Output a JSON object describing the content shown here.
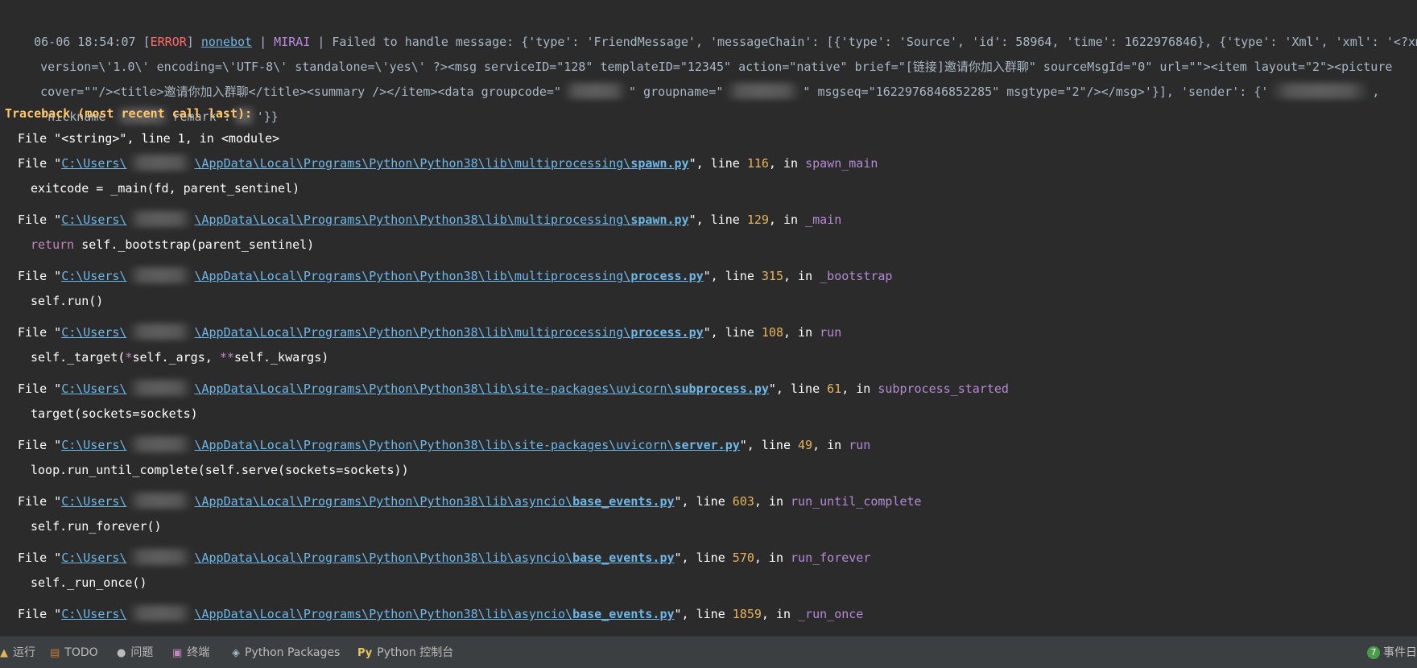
{
  "log": {
    "timestamp": "06-06 18:54:07",
    "level_open": "[",
    "level": "ERROR",
    "level_close": "]",
    "logger": "nonebot",
    "sep1": " | ",
    "adapter": "MIRAI",
    "sep2": " | ",
    "message_1": "Failed to handle message: {'type': 'FriendMessage', 'messageChain': [{'type': 'Source', 'id': 58964, 'time': 1622976846}, {'type': 'Xml', 'xml': '<?xml",
    "message_2": "version=\\'1.0\\' encoding=\\'UTF-8\\' standalone=\\'yes\\' ?><msg serviceID=\"128\" templateID=\"12345\" action=\"native\" brief=\"[链接]邀请你加入群聊\" sourceMsgId=\"0\" url=\"\"><item layout=\"2\"><picture",
    "message_3a": "cover=\"\"/><title>邀请你加入群聊</title><summary /></item><data groupcode=\"",
    "message_3b": "\" groupname=\"",
    "message_3c": "\" msgseq=\"1622976846852285\" msgtype=\"2\"/></msg>'}], 'sender': {'",
    "message_3d": ",",
    "message_4a": "'nickname'",
    "message_4b": "remark':",
    "message_4c": "'}}"
  },
  "traceback": {
    "header": "Traceback (most recent call last):",
    "first_frame": "File \"<string>\", line 1, in <module>",
    "path_prefix": "C:\\Users\\",
    "frames": [
      {
        "dir": "\\AppData\\Local\\Programs\\Python\\Python38\\lib\\multiprocessing\\",
        "file": "spawn.py",
        "line": "116",
        "func": "spawn_main",
        "code": "exitcode = _main(fd, parent_sentinel)"
      },
      {
        "dir": "\\AppData\\Local\\Programs\\Python\\Python38\\lib\\multiprocessing\\",
        "file": "spawn.py",
        "line": "129",
        "func": "_main",
        "code_kw": "return",
        "code": " self._bootstrap(parent_sentinel)"
      },
      {
        "dir": "\\AppData\\Local\\Programs\\Python\\Python38\\lib\\multiprocessing\\",
        "file": "process.py",
        "line": "315",
        "func": "_bootstrap",
        "code": "self.run()"
      },
      {
        "dir": "\\AppData\\Local\\Programs\\Python\\Python38\\lib\\multiprocessing\\",
        "file": "process.py",
        "line": "108",
        "func": "run",
        "code_a": "self._target(",
        "code_b": "*",
        "code_c": "self._args, ",
        "code_d": "**",
        "code_e": "self._kwargs)"
      },
      {
        "dir": "\\AppData\\Local\\Programs\\Python\\Python38\\lib\\site-packages\\uvicorn\\",
        "file": "subprocess.py",
        "line": "61",
        "func": "subprocess_started",
        "code": "target(sockets=sockets)"
      },
      {
        "dir": "\\AppData\\Local\\Programs\\Python\\Python38\\lib\\site-packages\\uvicorn\\",
        "file": "server.py",
        "line": "49",
        "func": "run",
        "code": "loop.run_until_complete(self.serve(sockets=sockets))"
      },
      {
        "dir": "\\AppData\\Local\\Programs\\Python\\Python38\\lib\\asyncio\\",
        "file": "base_events.py",
        "line": "603",
        "func": "run_until_complete",
        "code": "self.run_forever()"
      },
      {
        "dir": "\\AppData\\Local\\Programs\\Python\\Python38\\lib\\asyncio\\",
        "file": "base_events.py",
        "line": "570",
        "func": "run_forever",
        "code": "self._run_once()"
      },
      {
        "dir": "\\AppData\\Local\\Programs\\Python\\Python38\\lib\\asyncio\\",
        "file": "base_events.py",
        "line": "1859",
        "func": "_run_once"
      }
    ],
    "file_word": "File \"",
    "line_word": "\", line ",
    "in_word": ", in "
  },
  "toolbar": {
    "items": [
      {
        "label": "运行",
        "icon": "run-icon"
      },
      {
        "label": "TODO",
        "icon": "todo-icon"
      },
      {
        "label": "问题",
        "icon": "problems-icon"
      },
      {
        "label": "终端",
        "icon": "terminal-icon"
      },
      {
        "label": "Python Packages",
        "icon": "python-packages-icon"
      },
      {
        "label": "Python 控制台",
        "icon": "python-console-icon"
      }
    ],
    "event_log": {
      "label": "事件日",
      "count": "7"
    }
  },
  "colors": {
    "background": "#2b2b2b",
    "error": "#ff6b68",
    "traceback_header": "#ffc66d",
    "link": "#6fb7e6",
    "line_number": "#e8b45c",
    "function": "#b58bd6"
  }
}
